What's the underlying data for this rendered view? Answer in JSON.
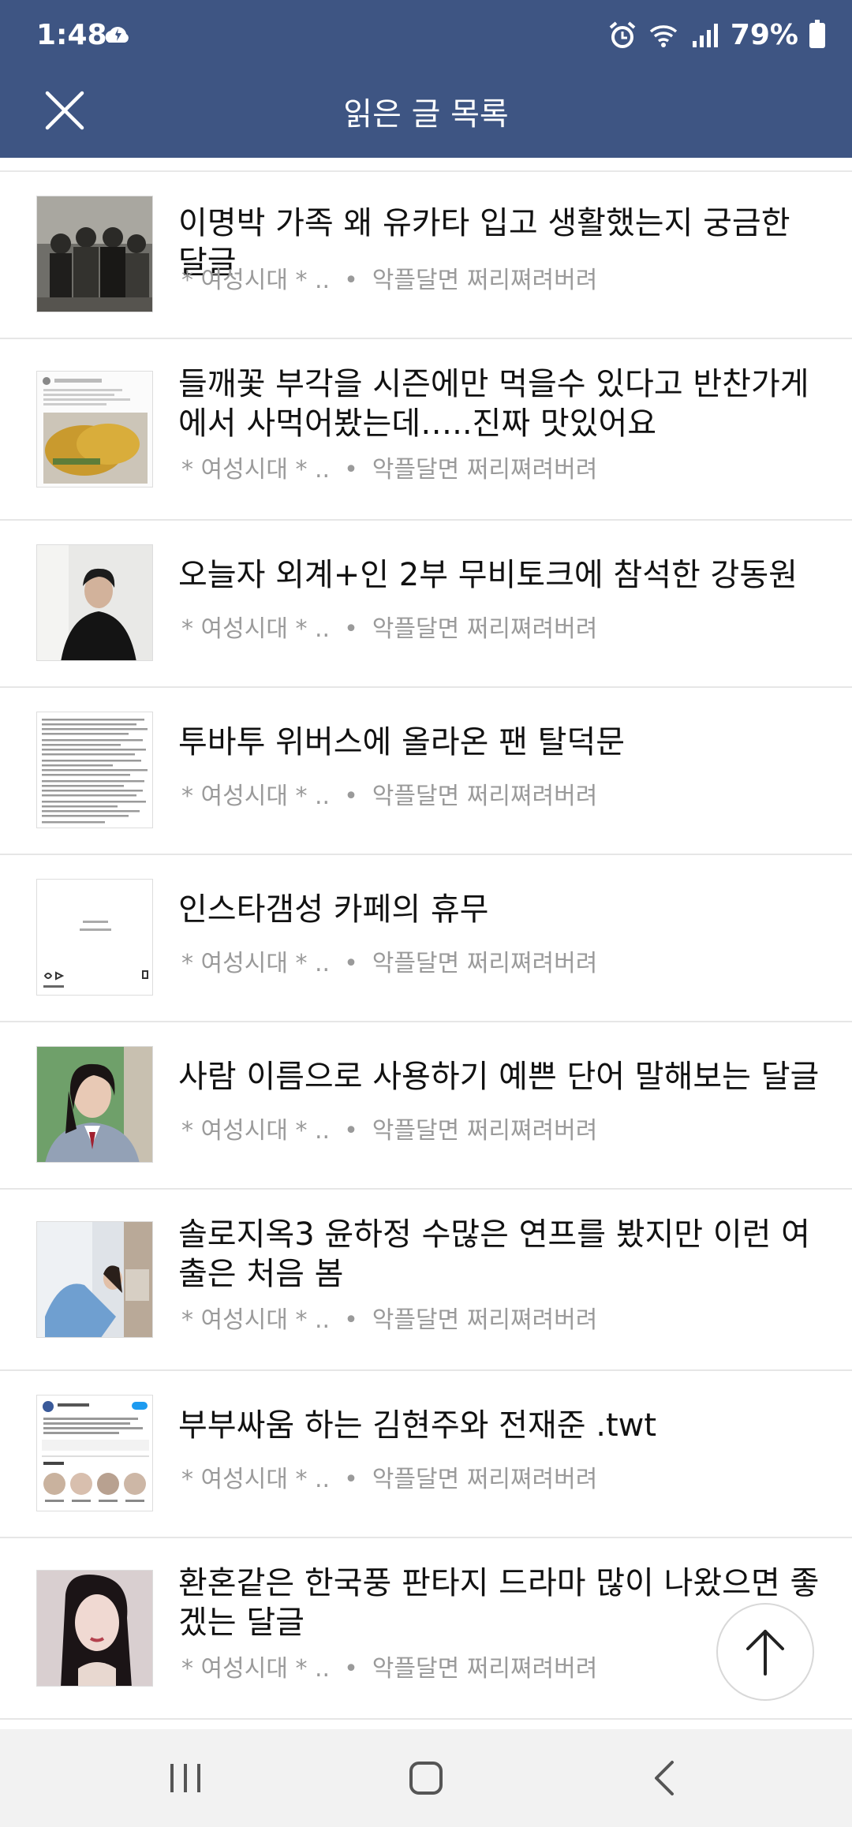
{
  "status": {
    "time": "1:48",
    "battery": "79%"
  },
  "header": {
    "title": "읽은 글 목록"
  },
  "items": [
    {
      "title": "이명박 가족 왜 유카타 입고 생활했는지 궁금한 달글",
      "board": "* 여성시대 *  ..",
      "author": "악플달면 쩌리쪄려버려",
      "thumb": "photo-bw-family"
    },
    {
      "title": "들깨꽃 부각을 시즌에만 먹을수 있다고 반찬가게에서 사먹어봤는데…..진짜 맛있어요",
      "board": "* 여성시대 *  ..",
      "author": "악플달면 쩌리쪄려버려",
      "thumb": "photo-food"
    },
    {
      "title": "오늘자 외계+인 2부 무비토크에 참석한 강동원",
      "board": "* 여성시대 *  ..",
      "author": "악플달면 쩌리쪄려버려",
      "thumb": "photo-person-dark"
    },
    {
      "title": "투바투 위버스에 올라온 팬 탈덕문",
      "board": "* 여성시대 *  ..",
      "author": "악플달면 쩌리쪄려버려",
      "thumb": "text-screenshot"
    },
    {
      "title": "인스타갬성 카페의 휴무",
      "board": "* 여성시대 *  ..",
      "author": "악플달면 쩌리쪄려버려",
      "thumb": "insta-post"
    },
    {
      "title": "사람 이름으로 사용하기 예쁜 단어 말해보는 달글",
      "board": "* 여성시대 *  ..",
      "author": "악플달면 쩌리쪄려버려",
      "thumb": "photo-student"
    },
    {
      "title": "솔로지옥3 윤하정 수많은 연프를 봤지만 이런 여출은 처음 봄",
      "board": "* 여성시대 *  ..",
      "author": "악플달면 쩌리쪄려버려",
      "thumb": "photo-room"
    },
    {
      "title": "부부싸움 하는 김현주와 전재준 .twt",
      "board": "* 여성시대 *  ..",
      "author": "악플달면 쩌리쪄려버려",
      "thumb": "twitter-screenshot"
    },
    {
      "title": "환혼같은 한국풍 판타지 드라마 많이 나왔으면 좋겠는 달글",
      "board": "* 여성시대 *  ..",
      "author": "악플달면 쩌리쪄려버려",
      "thumb": "photo-actress"
    }
  ],
  "icons": {
    "close": "close-icon",
    "scroll_top": "arrow-up-icon",
    "recents": "recents-icon",
    "home": "home-icon",
    "back": "back-icon"
  },
  "colors": {
    "header_bg": "#3e5583",
    "meta_text": "#9a9a9a",
    "title_text": "#111111"
  }
}
